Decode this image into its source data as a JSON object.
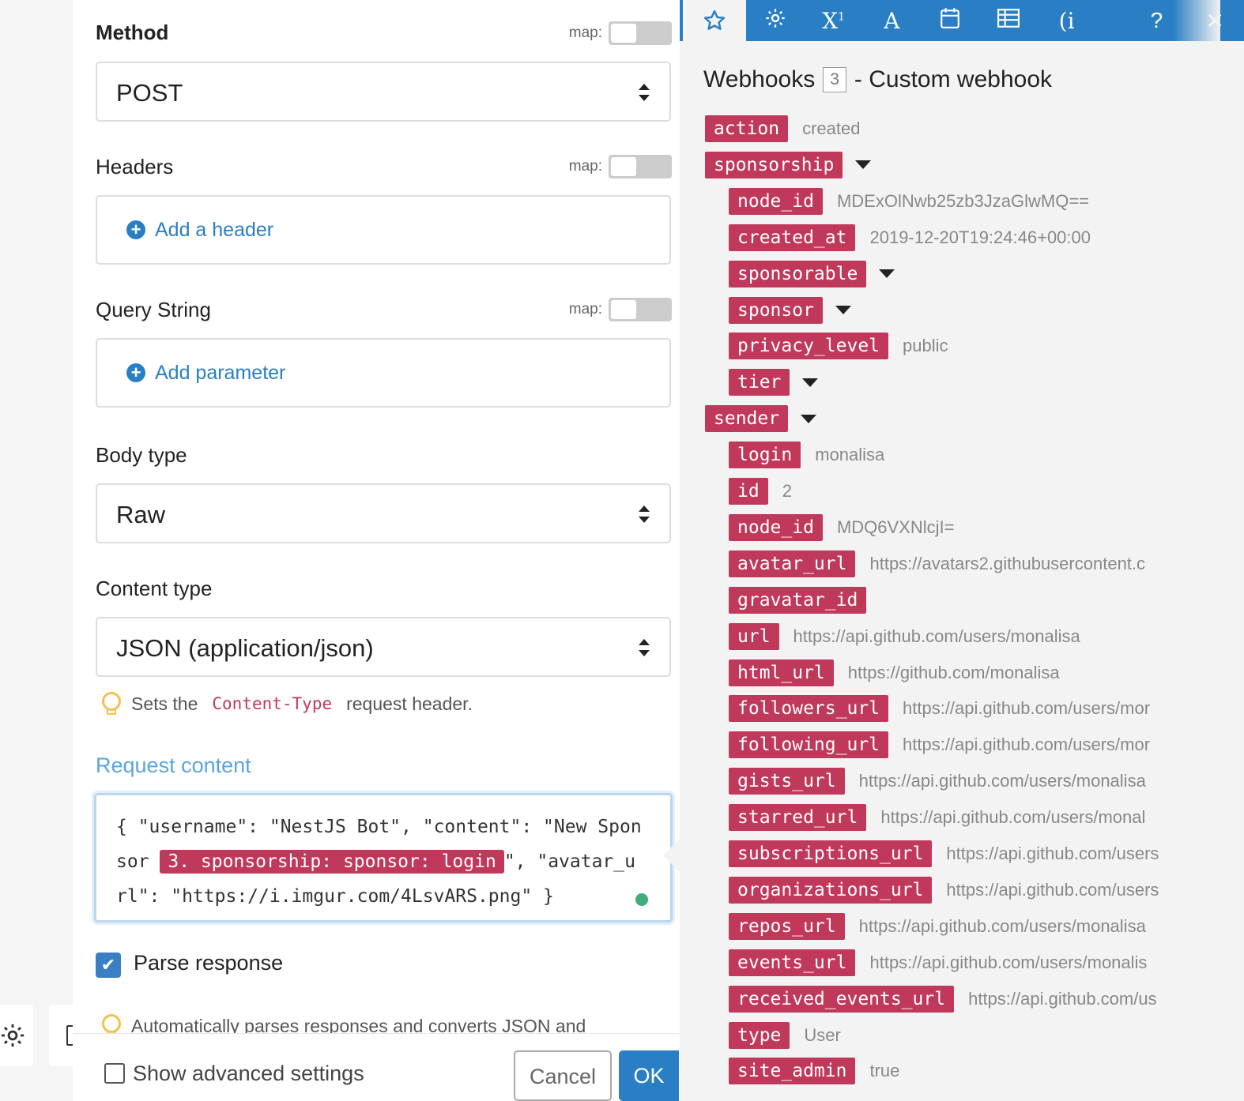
{
  "form": {
    "method_label": "Method",
    "map_label": "map:",
    "method_value": "POST",
    "headers_label": "Headers",
    "add_header": "Add a header",
    "query_label": "Query String",
    "add_parameter": "Add parameter",
    "body_type_label": "Body type",
    "body_type_value": "Raw",
    "content_type_label": "Content type",
    "content_type_value": "JSON (application/json)",
    "hint_prefix": "Sets the",
    "hint_code": "Content-Type",
    "hint_suffix": "request header.",
    "request_content_label": "Request content",
    "request_part1": "{ \"username\": \"NestJS Bot\", \"content\": \"New Sponsor ",
    "request_pill": "3. sponsorship: sponsor: login",
    "request_part2": "\", \"avatar_url\": \"https://i.imgur.com/4LsvARS.png\" }",
    "parse_response_label": "Parse response",
    "parse_hint": "Automatically parses responses and converts JSON and",
    "show_advanced": "Show advanced settings",
    "cancel": "Cancel",
    "ok": "OK"
  },
  "panel": {
    "title_prefix": "Webhooks",
    "count": "3",
    "title_suffix": "- Custom webhook",
    "toolbar_icons": [
      "star-icon",
      "gear-icon",
      "superscript-icon",
      "text-icon",
      "calendar-icon",
      "table-icon",
      "functions-icon",
      "help-icon",
      "close-icon"
    ],
    "items": [
      {
        "key": "action",
        "value": "created",
        "indent": 0,
        "expand": false
      },
      {
        "key": "sponsorship",
        "value": "",
        "indent": 0,
        "expand": true
      },
      {
        "key": "node_id",
        "value": "MDExOlNwb25zb3JzaGlwMQ==",
        "indent": 1,
        "expand": false
      },
      {
        "key": "created_at",
        "value": "2019-12-20T19:24:46+00:00",
        "indent": 1,
        "expand": false
      },
      {
        "key": "sponsorable",
        "value": "",
        "indent": 1,
        "expand": true
      },
      {
        "key": "sponsor",
        "value": "",
        "indent": 1,
        "expand": true
      },
      {
        "key": "privacy_level",
        "value": "public",
        "indent": 1,
        "expand": false
      },
      {
        "key": "tier",
        "value": "",
        "indent": 1,
        "expand": true
      },
      {
        "key": "sender",
        "value": "",
        "indent": 0,
        "expand": true
      },
      {
        "key": "login",
        "value": "monalisa",
        "indent": 1,
        "expand": false
      },
      {
        "key": "id",
        "value": "2",
        "indent": 1,
        "expand": false
      },
      {
        "key": "node_id",
        "value": "MDQ6VXNlcjI=",
        "indent": 1,
        "expand": false
      },
      {
        "key": "avatar_url",
        "value": "https://avatars2.githubusercontent.c",
        "indent": 1,
        "expand": false
      },
      {
        "key": "gravatar_id",
        "value": "",
        "indent": 1,
        "expand": false
      },
      {
        "key": "url",
        "value": "https://api.github.com/users/monalisa",
        "indent": 1,
        "expand": false
      },
      {
        "key": "html_url",
        "value": "https://github.com/monalisa",
        "indent": 1,
        "expand": false
      },
      {
        "key": "followers_url",
        "value": "https://api.github.com/users/mor",
        "indent": 1,
        "expand": false
      },
      {
        "key": "following_url",
        "value": "https://api.github.com/users/mor",
        "indent": 1,
        "expand": false
      },
      {
        "key": "gists_url",
        "value": "https://api.github.com/users/monalisa",
        "indent": 1,
        "expand": false
      },
      {
        "key": "starred_url",
        "value": "https://api.github.com/users/monal",
        "indent": 1,
        "expand": false
      },
      {
        "key": "subscriptions_url",
        "value": "https://api.github.com/users",
        "indent": 1,
        "expand": false
      },
      {
        "key": "organizations_url",
        "value": "https://api.github.com/users",
        "indent": 1,
        "expand": false
      },
      {
        "key": "repos_url",
        "value": "https://api.github.com/users/monalisa",
        "indent": 1,
        "expand": false
      },
      {
        "key": "events_url",
        "value": "https://api.github.com/users/monalis",
        "indent": 1,
        "expand": false
      },
      {
        "key": "received_events_url",
        "value": "https://api.github.com/us",
        "indent": 1,
        "expand": false
      },
      {
        "key": "type",
        "value": "User",
        "indent": 1,
        "expand": false
      },
      {
        "key": "site_admin",
        "value": "true",
        "indent": 1,
        "expand": false
      }
    ]
  }
}
